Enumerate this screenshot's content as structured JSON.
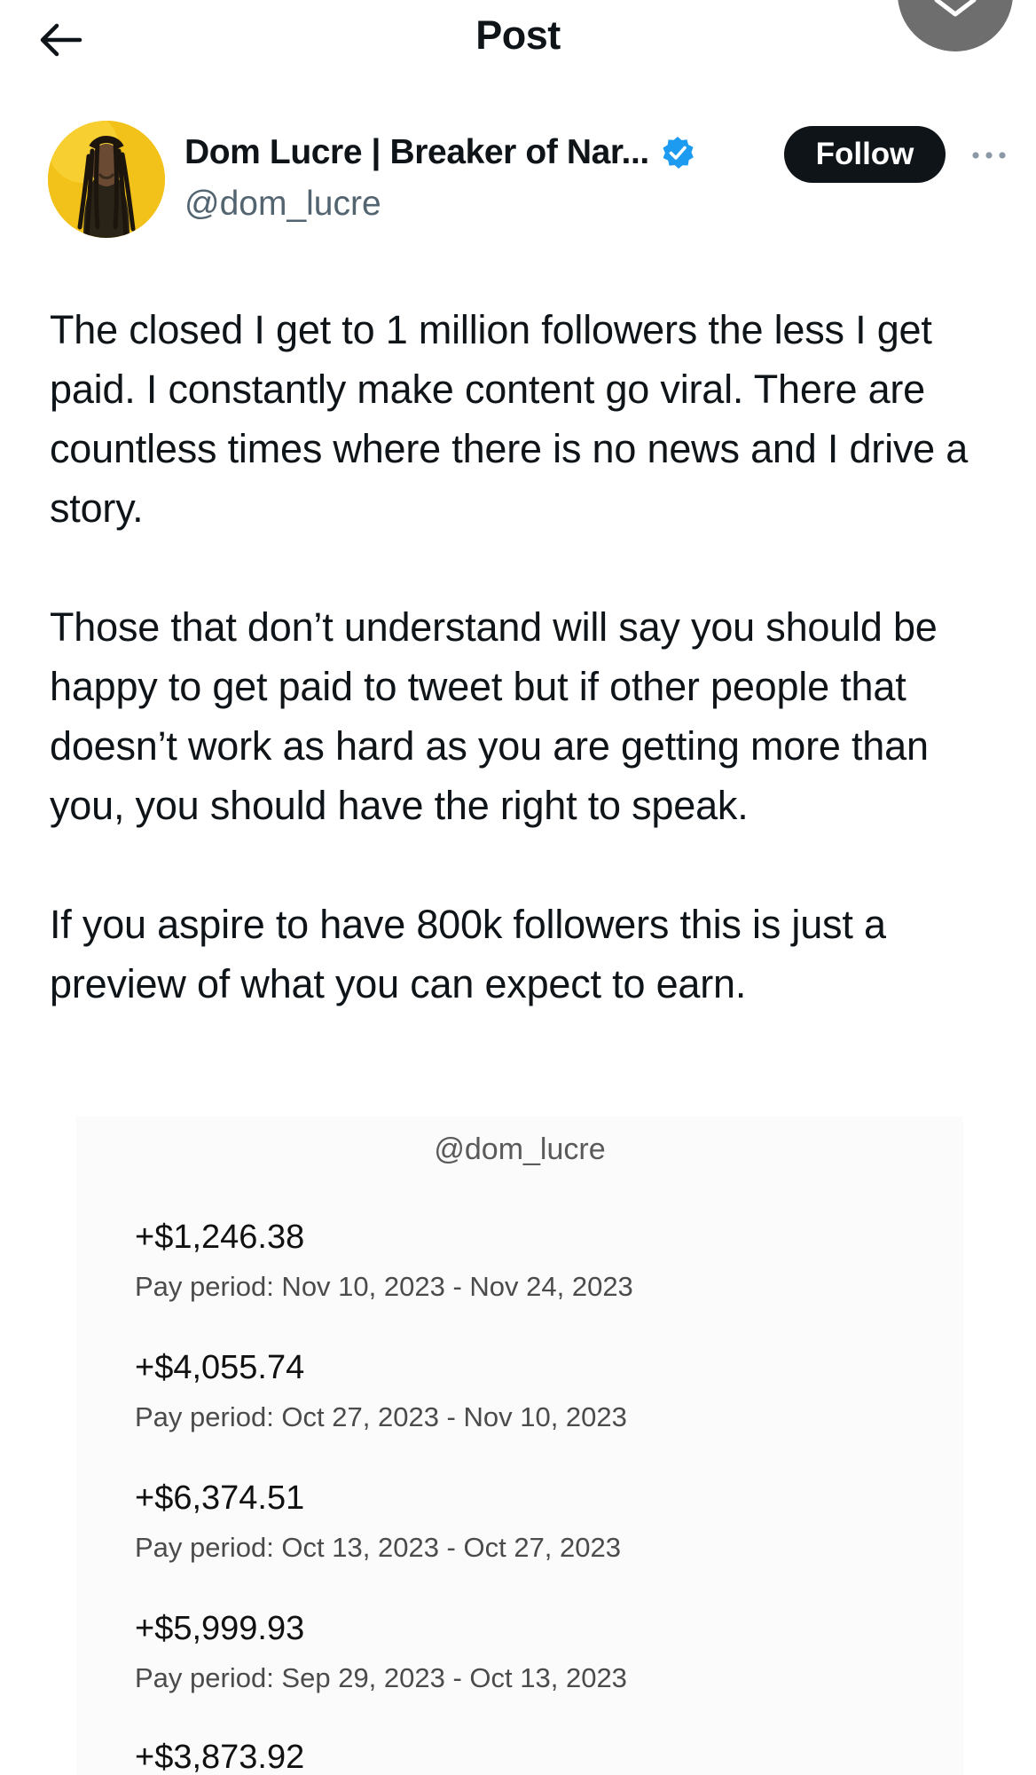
{
  "header": {
    "title": "Post"
  },
  "author": {
    "display_name": "Dom Lucre | Breaker of Nar...",
    "handle": "@dom_lucre",
    "follow_label": "Follow"
  },
  "tweet": {
    "paragraphs": [
      "The closed I get to 1 million followers the less I get paid. I constantly make content go viral. There are countless times where there is no news and I drive a story.",
      "Those that don’t understand will say you should be happy to get paid to tweet but if other people that doesn’t work as hard as you are getting more than you, you should have the right to speak.",
      "If you aspire to have 800k followers this is just a preview of what you can expect to earn."
    ]
  },
  "media": {
    "handle": "@dom_lucre",
    "payouts": [
      {
        "amount": "+$1,246.38",
        "period": "Pay period: Nov 10, 2023 - Nov 24, 2023"
      },
      {
        "amount": "+$4,055.74",
        "period": "Pay period: Oct 27, 2023 - Nov 10, 2023"
      },
      {
        "amount": "+$6,374.51",
        "period": "Pay period: Oct 13, 2023 - Oct 27, 2023"
      },
      {
        "amount": "+$5,999.93",
        "period": "Pay period: Sep 29, 2023 - Oct 13, 2023"
      },
      {
        "amount": "+$3,873.92",
        "period": ""
      }
    ]
  },
  "colors": {
    "text_primary": "#0f1419",
    "text_secondary": "#536471",
    "verified_blue": "#1d9bf0",
    "follow_button": "#0f1419"
  },
  "icons": {
    "back": "arrow-left-icon",
    "verified": "verified-badge-icon",
    "more": "more-horizontal-icon",
    "close": "close-icon"
  }
}
